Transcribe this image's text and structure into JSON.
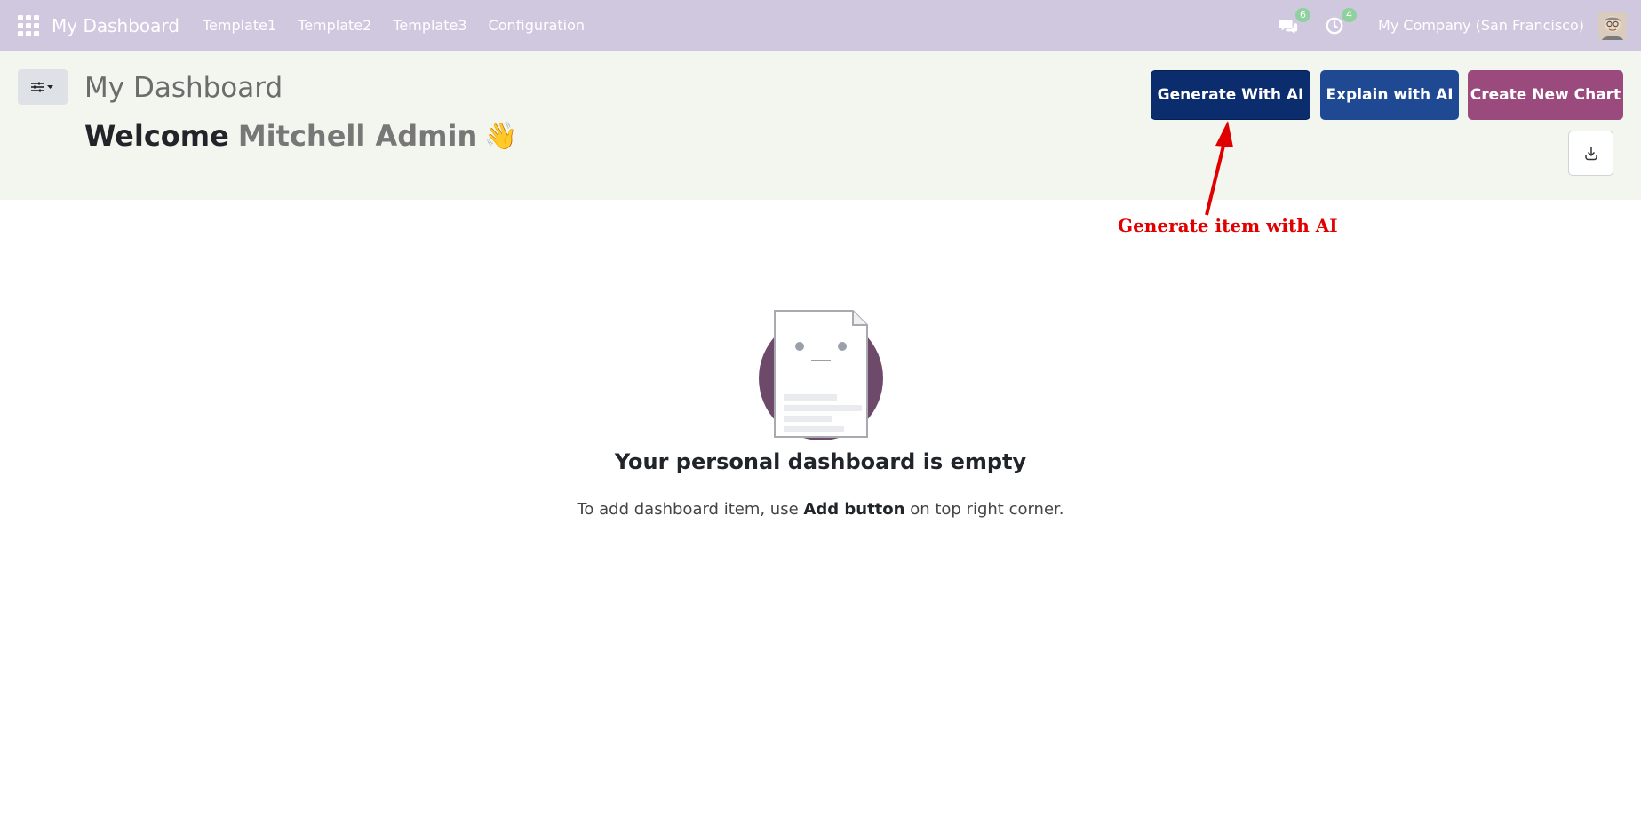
{
  "navbar": {
    "app_title": "My Dashboard",
    "menu_items": [
      "Template1",
      "Template2",
      "Template3",
      "Configuration"
    ],
    "messages_count": "6",
    "activities_count": "4",
    "company": "My Company (San Francisco)",
    "bg_color": "#cfc8df"
  },
  "control_panel": {
    "page_title": "My Dashboard",
    "welcome_prefix": "Welcome",
    "user_name": "Mitchell Admin",
    "wave_emoji": "👋",
    "generate_label": "Generate With AI",
    "explain_label": "Explain with AI",
    "create_label": "Create New Chart",
    "colors": {
      "generate": "#0b2d6e",
      "explain": "#1f4a93",
      "create": "#9b4a7d"
    }
  },
  "annotation": {
    "text": "Generate item with AI",
    "color": "#e00000"
  },
  "empty_state": {
    "title": "Your personal dashboard is empty",
    "help_prefix": "To add dashboard item, use ",
    "help_bold": "Add button",
    "help_suffix": " on top right corner."
  },
  "icons": {
    "apps": "apps-grid-icon",
    "messages": "chat-bubbles-icon",
    "activities": "clock-activity-icon",
    "filter": "sliders-icon",
    "download": "download-icon"
  }
}
